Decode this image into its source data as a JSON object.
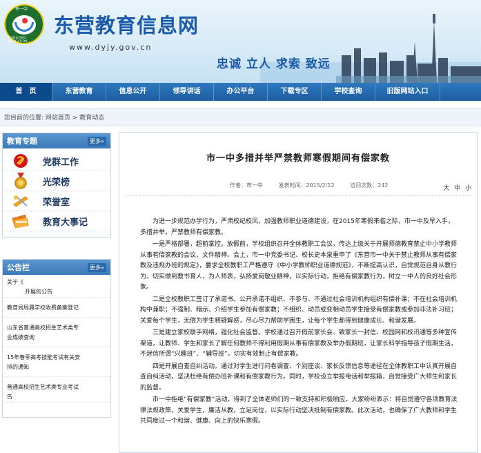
{
  "header": {
    "logo_text": "市一中",
    "logo_sub": "DONGYING EDUCATION",
    "site_title": "东营教育信息网",
    "site_url": "www.dyjy.gov.cn",
    "slogan": "忠诚 立人 求索 致远"
  },
  "nav": {
    "items": [
      {
        "label": "首　页",
        "active": true
      },
      {
        "label": "东营教育",
        "active": false
      },
      {
        "label": "信息公开",
        "active": false
      },
      {
        "label": "领导讲话",
        "active": false
      },
      {
        "label": "办公平台",
        "active": false
      },
      {
        "label": "下载专区",
        "active": false
      },
      {
        "label": "学校查询",
        "active": false
      },
      {
        "label": "旧版网站入口",
        "active": false
      }
    ]
  },
  "breadcrumb": {
    "prefix": "您目前的位置:",
    "home": "网站首页",
    "sep": " > ",
    "current": "教育动态"
  },
  "sidebar": {
    "topics": {
      "title": "教育专题",
      "more": "更多»",
      "items": [
        {
          "label": "党群工作",
          "icon": "party-emblem-icon"
        },
        {
          "label": "光荣榜",
          "icon": "medal-icon"
        },
        {
          "label": "荣誉室",
          "icon": "trophy-icon"
        },
        {
          "label": "教育大事记",
          "icon": "book-icon"
        }
      ]
    },
    "notices": {
      "title": "公告栏",
      "more": "更多»",
      "items": [
        "关于《",
        "开展的公告",
        "教育局局属学校收费备案登记",
        "山东省普通高校招生艺术类专",
        "业成绩查询",
        "15年春季高考技能考试有关安",
        "排的通知",
        "普通高校招生艺术类专业考试",
        "告"
      ]
    }
  },
  "article": {
    "title": "市一中多措并举严禁教师寒假期间有偿家教",
    "author_label": "作者：市一中",
    "date_label": "发表时间：2015/2/12",
    "views_label": "访问次数：242",
    "font_sizes": [
      "大",
      "中",
      "小"
    ],
    "paragraphs": [
      "为进一步规范办学行为，严肃校纪校风，加强教师职业道德建设，在2015年寒假来临之际，市一中及早入手，多措并举，严禁教师有偿家教。",
      "一是严格部署，超前掌控。放假前，学校组织召开全体教职工会议，传达上级关于开展师德教育禁止中小学教师从事有偿家教的会议、文件精神。会上，市一中党委书记、校长史本泉重申了《东营市一中关于禁止教师从事有偿家教及违规办班的规定》，要求全校教职工严格遵守《中小学教师职业道德规范》，不断提高认识，自觉规范自身从教行为，切实做到教书育人，为人师表，弘扬爱岗敬业精神，以实际行动，拒绝有偿家教行为，树立一中人的良好社会形象。",
      "二是全校教职工签订了承诺书。公开承诺不组织、不参与、不通过社会培训机构组织有偿补课；不在社会培训机构中兼职；不强制、暗示、介绍学生参加有偿家教；不组织、动员或变相动员学生接受有偿家教或参加非法补习班；关爱每个学生，无偿为学生释疑解惑，尽心尽力帮助学困生，让每个学生都得到健康成长、和谐发展。",
      "三是建立家校联手网络，强化社会监督。学校通过召开假前家长会、致家长一封信、校园网和校讯通等多种宣传渠道，让教师、学生和家长了解任何教师不得利用假期从事有偿家教及举办假期班，让家长科学指导孩子假期生活，不迷信所谓“兴趣班”、“辅导班”，切实有效制止有偿家教。",
      "四是开展自查自纠活动。通过对学生进行问卷调查、个别座谈、家长反馈信息等途径在全体教职工中认真开展自查自纠活动，坚决杜绝有偿办班补课和有偿家教行为。同时，学校设立举报电话和举报箱，自觉接受广大师生和家长的监督。",
      "市一中拒绝“有偿家教”活动，得到了全体老师们的一致支持和积极响应。大家纷纷表示：将自觉遵守各项教育法律法规政策，关爱学生，廉洁从教，立足岗位，以实际行动坚决抵制有偿家教。此次活动，也确保了广大教师和学生共同度过一个和谐、健康、向上的快乐寒假。"
    ]
  },
  "colors": {
    "nav_bg": "#1b5d9f",
    "title_blue": "#1a5aa8",
    "side_head": "#3b78b8"
  }
}
